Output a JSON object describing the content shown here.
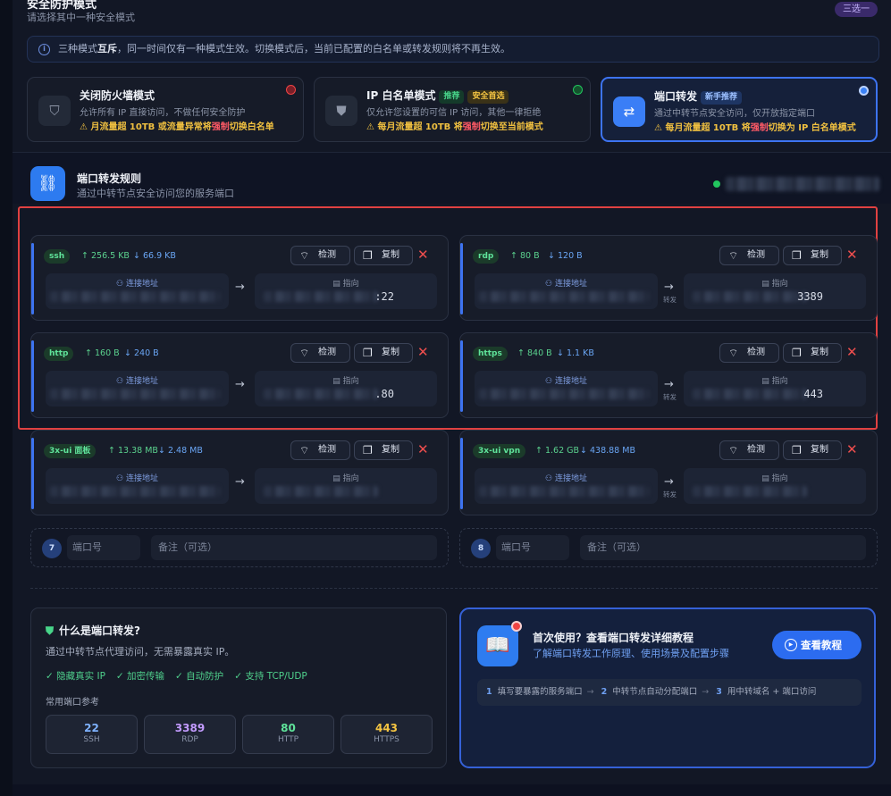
{
  "header": {
    "title": "安全防护模式",
    "subtitle": "请选择其中一种安全模式",
    "badge": "三选一"
  },
  "info": {
    "text_pre": "三种模式",
    "text_bold": "互斥",
    "text_post": "，同一时间仅有一种模式生效。切换模式后，当前已配置的白名单或转发规则将不再生效。"
  },
  "modes": [
    {
      "title": "关闭防火墙模式",
      "desc": "允许所有 IP 直接访问，不做任何安全防护",
      "warn_pre": "月流量超 10TB 或流量异常将",
      "warn_red": "强制",
      "warn_post": "切换白名单",
      "tags": [],
      "corner_color": "#ef4444"
    },
    {
      "title": "IP 白名单模式",
      "desc": "仅允许您设置的可信 IP 访问，其他一律拒绝",
      "warn_pre": "每月流量超 10TB 将",
      "warn_red": "强制",
      "warn_post": "切换至当前模式",
      "tags": [
        "推荐",
        "安全首选"
      ],
      "corner_color": "#22c55e"
    },
    {
      "title": "端口转发",
      "desc": "通过中转节点安全访问，仅开放指定端口",
      "warn_pre": "每月流量超 10TB 将",
      "warn_red": "强制",
      "warn_post": "切换为 IP 白名单模式",
      "tags": [
        "新手推荐"
      ],
      "corner_color": "#3b82f6"
    }
  ],
  "section": {
    "title": "端口转发规则",
    "subtitle": "通过中转节点安全访问您的服务端口"
  },
  "rules": [
    {
      "name": "ssh",
      "up": "256.5 KB",
      "down": "66.9 KB",
      "port": ":22",
      "forward_label": ""
    },
    {
      "name": "rdp",
      "up": "80 B",
      "down": "120 B",
      "port": "3389",
      "forward_label": "转发"
    },
    {
      "name": "http",
      "up": "160 B",
      "down": "240 B",
      "port": ".80",
      "forward_label": ""
    },
    {
      "name": "https",
      "up": "840 B",
      "down": "1.1 KB",
      "port": "443",
      "forward_label": "转发"
    },
    {
      "name": "3x-ui 面板",
      "up": "13.38 MB",
      "down": "2.48 MB",
      "port": "",
      "forward_label": ""
    },
    {
      "name": "3x-ui vpn",
      "up": "1.62 GB",
      "down": "438.88 MB",
      "port": "",
      "forward_label": "转发"
    }
  ],
  "labels": {
    "detect": "检测",
    "copy": "复制",
    "src": "连接地址",
    "dst": "指向",
    "close": "✕"
  },
  "add_rows": [
    {
      "num": "7",
      "port_ph": "端口号",
      "remark_ph": "备注（可选）"
    },
    {
      "num": "8",
      "port_ph": "端口号",
      "remark_ph": "备注（可选）"
    }
  ],
  "what": {
    "title": "什么是端口转发?",
    "desc": "通过中转节点代理访问，无需暴露真实 IP。",
    "features": [
      "✓ 隐藏真实 IP",
      "✓ 加密传输",
      "✓ 自动防护",
      "✓ 支持 TCP/UDP"
    ],
    "ref_title": "常用端口参考",
    "ports": [
      {
        "num": "22",
        "label": "SSH",
        "color": "#7fb2ff"
      },
      {
        "num": "3389",
        "label": "RDP",
        "color": "#c39bff"
      },
      {
        "num": "80",
        "label": "HTTP",
        "color": "#5fe39a"
      },
      {
        "num": "443",
        "label": "HTTPS",
        "color": "#f5c542"
      }
    ]
  },
  "tutorial": {
    "title": "首次使用？查看端口转发详细教程",
    "subtitle": "了解端口转发工作原理、使用场景及配置步骤",
    "button": "查看教程",
    "steps": [
      {
        "n": "1",
        "t": "填写要暴露的服务端口"
      },
      {
        "n": "2",
        "t": "中转节点自动分配端口"
      },
      {
        "n": "3",
        "t": "用中转域名 + 端口访问"
      }
    ]
  }
}
